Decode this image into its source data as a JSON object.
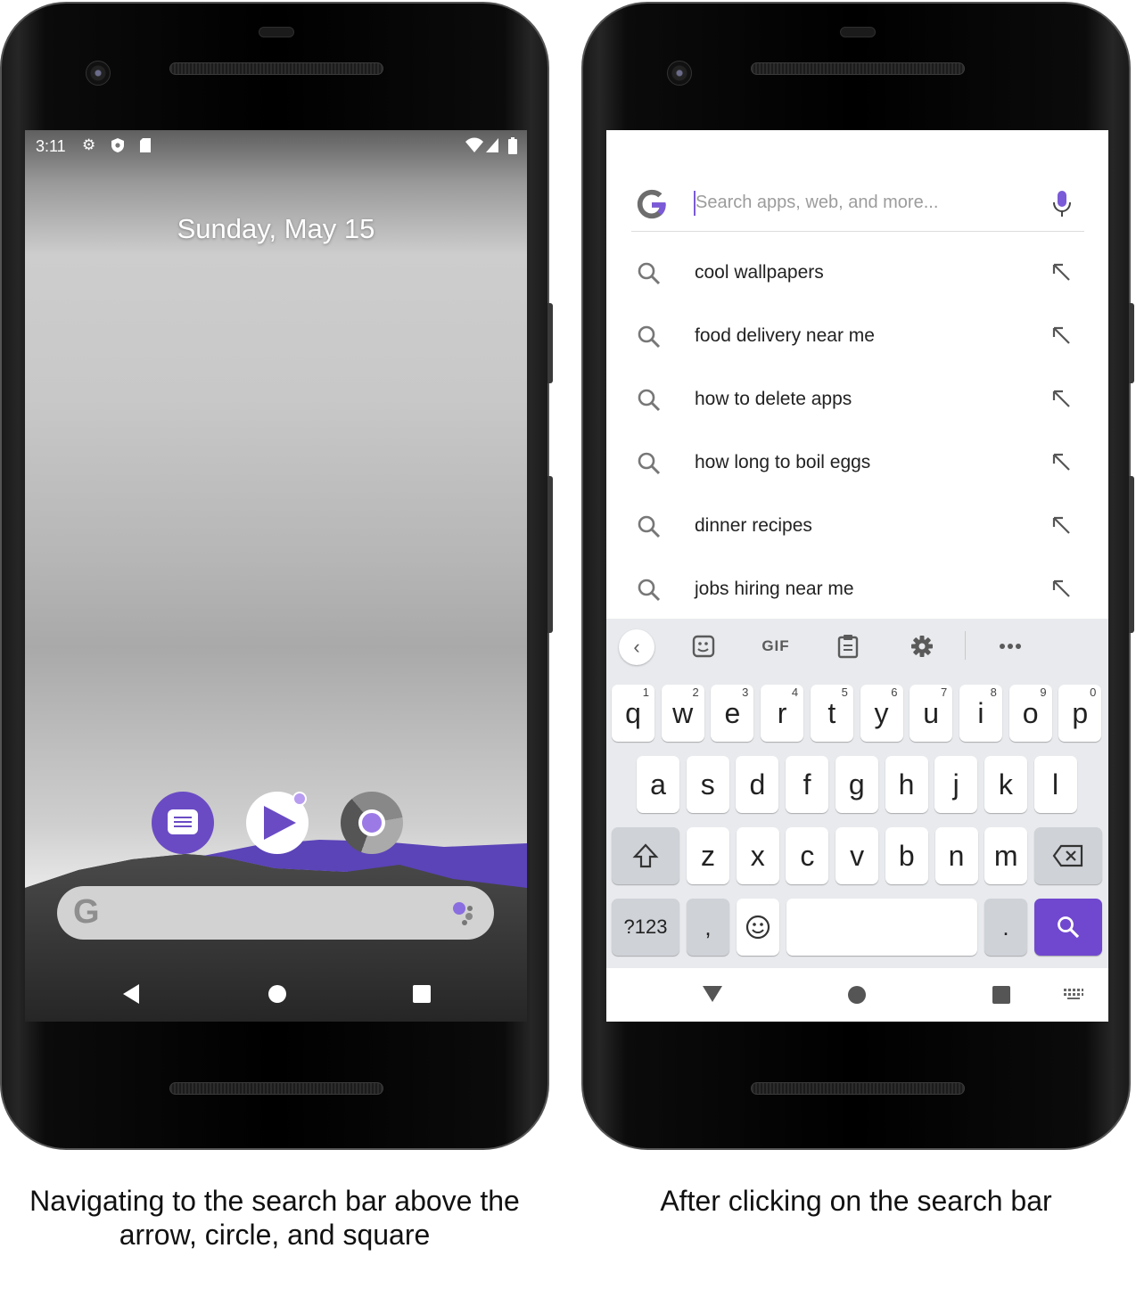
{
  "left_phone": {
    "status_bar": {
      "time": "3:11",
      "left_icons": [
        "settings-gear-icon",
        "shield-icon",
        "sd-card-icon"
      ],
      "right_icons": [
        "wifi-icon",
        "cell-signal-icon",
        "battery-icon"
      ]
    },
    "date": "Sunday, May 15",
    "dock_apps": [
      "messages-app-icon",
      "play-app-icon",
      "chrome-app-icon"
    ],
    "search_bar": {
      "logo": "G",
      "assistant_icon": "google-assistant-icon"
    },
    "nav_buttons": [
      "back",
      "home",
      "recents"
    ],
    "colors": {
      "accent": "#6a4bc4",
      "hills": "#5b43b8"
    }
  },
  "right_phone": {
    "search": {
      "placeholder": "Search apps, web, and more...",
      "value": "",
      "mic_icon": "microphone-icon"
    },
    "suggestions": [
      "cool wallpapers",
      "food delivery near me",
      "how to delete apps",
      "how long to boil eggs",
      "dinner recipes",
      "jobs hiring near me"
    ],
    "keyboard": {
      "toolbar": {
        "gif_label": "GIF",
        "icons": [
          "chevron-left-icon",
          "sticker-icon",
          "gif-icon",
          "clipboard-icon",
          "gear-icon",
          "more-icon"
        ]
      },
      "row1": [
        {
          "k": "q",
          "h": "1"
        },
        {
          "k": "w",
          "h": "2"
        },
        {
          "k": "e",
          "h": "3"
        },
        {
          "k": "r",
          "h": "4"
        },
        {
          "k": "t",
          "h": "5"
        },
        {
          "k": "y",
          "h": "6"
        },
        {
          "k": "u",
          "h": "7"
        },
        {
          "k": "i",
          "h": "8"
        },
        {
          "k": "o",
          "h": "9"
        },
        {
          "k": "p",
          "h": "0"
        }
      ],
      "row2": [
        "a",
        "s",
        "d",
        "f",
        "g",
        "h",
        "j",
        "k",
        "l"
      ],
      "row3": [
        "z",
        "x",
        "c",
        "v",
        "b",
        "n",
        "m"
      ],
      "row4": {
        "symbols": "?123",
        "comma": ",",
        "period": "."
      }
    },
    "colors": {
      "accent": "#7048cf"
    }
  },
  "captions": {
    "left": "Navigating to the search bar above the arrow, circle, and square",
    "right": "After clicking on the search bar"
  }
}
